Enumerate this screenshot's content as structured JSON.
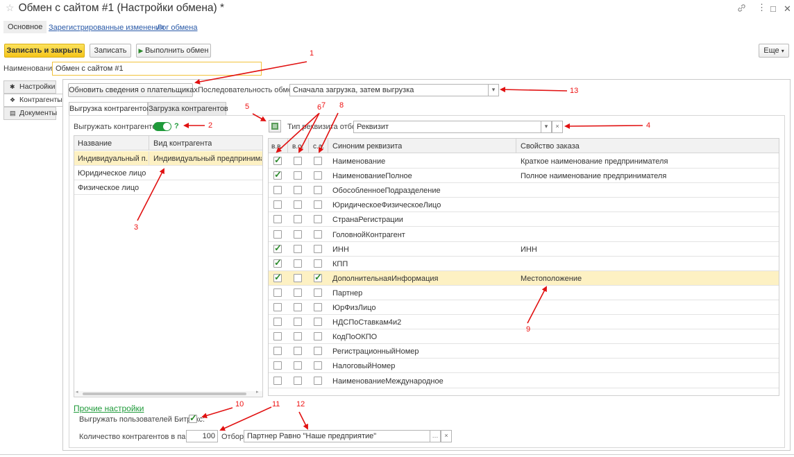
{
  "window": {
    "title": "Обмен с сайтом #1 (Настройки обмена) *"
  },
  "icons": {
    "star": "star-icon",
    "link": "link-icon",
    "menu": "more-vertical-icon",
    "maximize": "maximize-icon",
    "close": "close-icon"
  },
  "tabs": {
    "main": "Основное",
    "changes": "Зарегистрированные изменения",
    "log": "Лог обмена"
  },
  "toolbar": {
    "save_close": "Записать и закрыть",
    "save": "Записать",
    "run": "Выполнить обмен",
    "more": "Еще"
  },
  "name": {
    "label": "Наименование:",
    "value": "Обмен с сайтом #1"
  },
  "sidebar": {
    "items": [
      "Настройки",
      "Контрагенты",
      "Документы"
    ]
  },
  "payers_button": "Обновить сведения о плательщиках",
  "sequence": {
    "label": "Последовательность обмена:",
    "value": "Сначала загрузка, затем выгрузка"
  },
  "inner_tabs": [
    "Выгрузка контрагентов",
    "Загрузка контрагентов"
  ],
  "export": {
    "label": "Выгружать контрагентов:",
    "help": "?"
  },
  "left_table": {
    "headers": [
      "Название",
      "Вид контрагента"
    ],
    "rows": [
      [
        "Индивидуальный п...",
        "Индивидуальный предприниматель"
      ],
      [
        "Юридическое лицо",
        ""
      ],
      [
        "Физическое лицо",
        ""
      ]
    ]
  },
  "filter": {
    "label": "Тип реквизита отбор:",
    "value": "Реквизит"
  },
  "right_table": {
    "headers": [
      "в.в.",
      "в.о.",
      "с.а.",
      "Синоним реквизита",
      "Свойство заказа"
    ],
    "rows": [
      {
        "vv": true,
        "vo": false,
        "sa": false,
        "name": "Наименование",
        "prop": "Краткое наименование предпринимателя"
      },
      {
        "vv": true,
        "vo": false,
        "sa": false,
        "name": "НаименованиеПолное",
        "prop": "Полное наименование предпринимателя"
      },
      {
        "vv": false,
        "vo": false,
        "sa": false,
        "name": "ОбособленноеПодразделение",
        "prop": ""
      },
      {
        "vv": false,
        "vo": false,
        "sa": false,
        "name": "ЮридическоеФизическоеЛицо",
        "prop": ""
      },
      {
        "vv": false,
        "vo": false,
        "sa": false,
        "name": "СтранаРегистрации",
        "prop": ""
      },
      {
        "vv": false,
        "vo": false,
        "sa": false,
        "name": "ГоловнойКонтрагент",
        "prop": ""
      },
      {
        "vv": true,
        "vo": false,
        "sa": false,
        "name": "ИНН",
        "prop": "ИНН"
      },
      {
        "vv": true,
        "vo": false,
        "sa": false,
        "name": "КПП",
        "prop": ""
      },
      {
        "vv": true,
        "vo": false,
        "sa": true,
        "name": "ДополнительнаяИнформация",
        "prop": "Местоположение",
        "selected": true
      },
      {
        "vv": false,
        "vo": false,
        "sa": false,
        "name": "Партнер",
        "prop": ""
      },
      {
        "vv": false,
        "vo": false,
        "sa": false,
        "name": "ЮрФизЛицо",
        "prop": ""
      },
      {
        "vv": false,
        "vo": false,
        "sa": false,
        "name": "НДСПоСтавкам4и2",
        "prop": ""
      },
      {
        "vv": false,
        "vo": false,
        "sa": false,
        "name": "КодПоОКПО",
        "prop": ""
      },
      {
        "vv": false,
        "vo": false,
        "sa": false,
        "name": "РегистрационныйНомер",
        "prop": ""
      },
      {
        "vv": false,
        "vo": false,
        "sa": false,
        "name": "НалоговыйНомер",
        "prop": ""
      },
      {
        "vv": false,
        "vo": false,
        "sa": false,
        "name": "НаименованиеМеждународное",
        "prop": ""
      }
    ]
  },
  "other": {
    "title": "Прочие настройки",
    "bitrix_label": "Выгружать пользователей Битрикс:",
    "count_label": "Количество контрагентов в пакете:",
    "count_value": "100",
    "filter_label": "Отбор:",
    "filter_value": "Партнер Равно \"Наше предприятие\""
  },
  "annotations": [
    "1",
    "2",
    "3",
    "4",
    "5",
    "6",
    "7",
    "8",
    "9",
    "10",
    "11",
    "12",
    "13"
  ],
  "colors": {
    "accent_yellow": "#f5c51b",
    "toggle_green": "#1f9a3a",
    "annotation_red": "#e11111",
    "selected_row": "#fdf1c3"
  }
}
